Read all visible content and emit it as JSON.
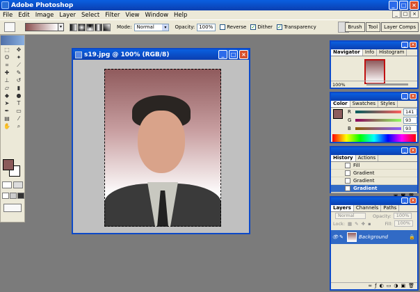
{
  "app": {
    "title": "Adobe Photoshop"
  },
  "menu": [
    "File",
    "Edit",
    "Image",
    "Layer",
    "Select",
    "Filter",
    "View",
    "Window",
    "Help"
  ],
  "options": {
    "mode_label": "Mode:",
    "mode_value": "Normal",
    "opacity_label": "Opacity:",
    "opacity_value": "100%",
    "reverse": "Reverse",
    "dither": "Dither",
    "transparency": "Transparency",
    "check_mark": "✓"
  },
  "palette_well": [
    "Brush",
    "Tool",
    "Layer Comps"
  ],
  "document": {
    "title": "s19.jpg @ 100% (RGB/8)"
  },
  "navigator": {
    "tabs": [
      "Navigator",
      "Info",
      "Histogram"
    ],
    "zoom": "100%"
  },
  "color": {
    "tabs": [
      "Color",
      "Swatches",
      "Styles"
    ],
    "channels": [
      {
        "label": "R",
        "value": "141"
      },
      {
        "label": "G",
        "value": "93"
      },
      {
        "label": "B",
        "value": "93"
      }
    ],
    "foreground": "#8d5d5d"
  },
  "history": {
    "tabs": [
      "History",
      "Actions"
    ],
    "items": [
      {
        "label": "Fill",
        "active": false
      },
      {
        "label": "Gradient",
        "active": false
      },
      {
        "label": "Gradient",
        "active": false
      },
      {
        "label": "Gradient",
        "active": true
      }
    ]
  },
  "layers": {
    "tabs": [
      "Layers",
      "Channels",
      "Paths"
    ],
    "blend": "Normal",
    "opacity_label": "Opacity:",
    "opacity_value": "100%",
    "lock_label": "Lock:",
    "fill_label": "Fill:",
    "fill_value": "100%",
    "layer_name": "Background"
  },
  "icons": {
    "minimize": "_",
    "maximize": "□",
    "close": "×",
    "dropdown": "▾",
    "eye": "👁",
    "lock": "🔒"
  }
}
